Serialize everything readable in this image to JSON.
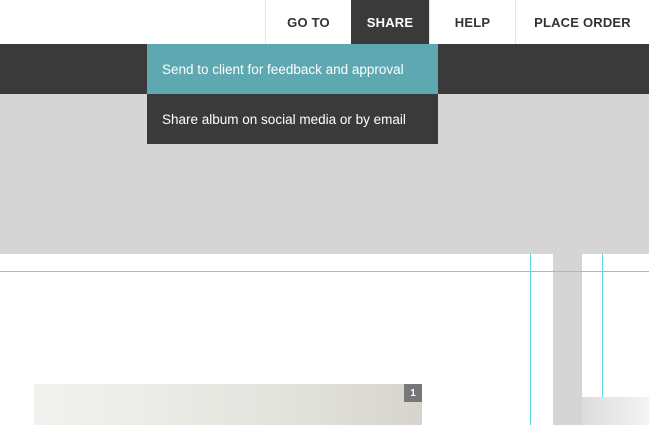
{
  "nav": {
    "items": [
      {
        "label": "GO TO"
      },
      {
        "label": "SHARE"
      },
      {
        "label": "HELP"
      },
      {
        "label": "PLACE ORDER"
      }
    ]
  },
  "share_menu": {
    "items": [
      {
        "label": "Send to client for feedback and approval",
        "active": true
      },
      {
        "label": "Share album on social media or by email",
        "active": false
      }
    ]
  },
  "album": {
    "page_badge": "1"
  },
  "colors": {
    "dark": "#3a3a3a",
    "accent": "#5ea8b2",
    "panel_gray": "#d5d5d5",
    "guide_line": "#5fd8e6"
  }
}
